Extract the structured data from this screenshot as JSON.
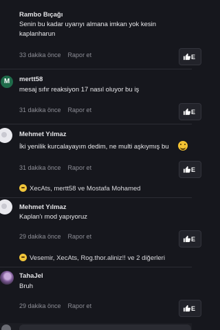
{
  "comments": [
    {
      "username": "Rambo Bıçağı",
      "text": "Senin bu kadar uyarıyı almana imkan yok kesin kaplanharun",
      "time": "33 dakika önce",
      "report": "Rapor et"
    },
    {
      "avatar_letter": "M",
      "username": "mertt58",
      "text": "mesaj sıfır reaksiyon 17 nasıl oluyor bu iş",
      "time": "31 dakika önce",
      "report": "Rapor et"
    },
    {
      "username": "Mehmet Yılmaz",
      "text": "İki yenilik kurcalayayım dedim, ne multi aşkıymış bu",
      "time": "31 dakika önce",
      "report": "Rapor et",
      "reactions": "XecAts, mertt58 ve Mostafa Mohamed"
    },
    {
      "username": "Mehmet Yılmaz",
      "text": "Kaplan'ı mod yapıyoruz",
      "time": "29 dakika önce",
      "report": "Rapor et",
      "reactions": "Vesemir, XecAts, Rog.thor.aliniz!! ve 2 diğerleri"
    },
    {
      "username": "TahaJel",
      "text": "Bruh",
      "time": "29 dakika önce",
      "report": "Rapor et"
    }
  ],
  "like_button_cut_text": "E",
  "colors": {
    "background": "#16171d",
    "accent_like": "#ffffff",
    "reaction_emoji": "#f0c53a"
  }
}
